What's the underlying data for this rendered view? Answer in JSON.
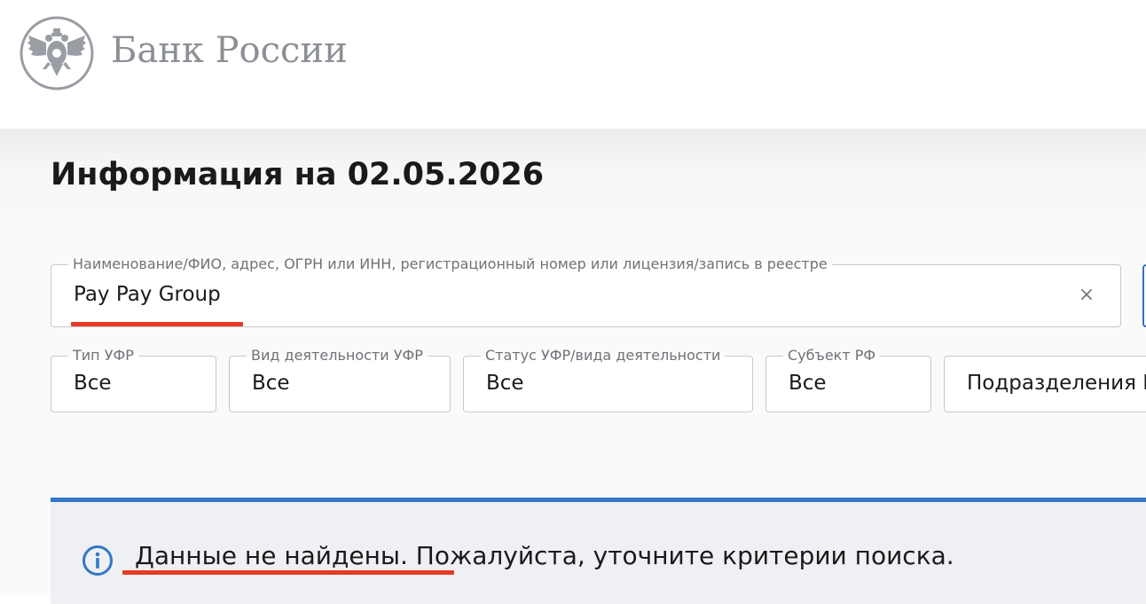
{
  "header": {
    "logo_text": "Банк России"
  },
  "page": {
    "title": "Информация на 02.05.2026"
  },
  "search": {
    "label": "Наименование/ФИО, адрес, ОГРН или ИНН, регистрационный номер или лицензия/запись в реестре",
    "value": "Pay Pay Group",
    "clear_symbol": "×"
  },
  "filters": [
    {
      "label": "Тип УФР",
      "value": "Все"
    },
    {
      "label": "Вид деятельности УФР",
      "value": "Все"
    },
    {
      "label": "Статус УФР/вида деятельности",
      "value": "Все"
    },
    {
      "label": "Субъект РФ",
      "value": "Все"
    },
    {
      "label": "",
      "value": "Подразделения К"
    }
  ],
  "alert": {
    "message": "Данные не найдены. Пожалуйста, уточните критерии поиска.",
    "icon": "info-icon"
  },
  "colors": {
    "accent_blue": "#3278c7",
    "annotation_red": "#e73a24",
    "logo_gray": "#8c9096"
  }
}
